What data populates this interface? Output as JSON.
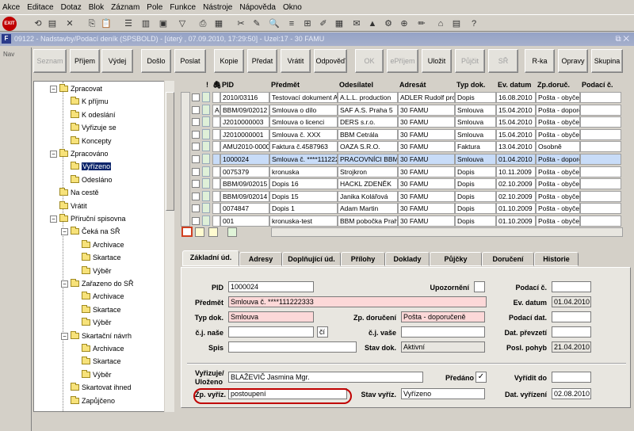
{
  "menu": [
    "Akce",
    "Editace",
    "Dotaz",
    "Blok",
    "Záznam",
    "Pole",
    "Funkce",
    "Nástroje",
    "Nápověda",
    "Okno"
  ],
  "toolbar": {
    "exit_label": "EXIT",
    "icons": [
      "save-icon",
      "print-icon",
      "cut-icon",
      "copy-icon",
      "paste-icon",
      "search-icon",
      "help-icon"
    ]
  },
  "window": {
    "title": "09122 - Nadstavby/Podací deník (SPSBOLD) - [úterý , 07.09.2010, 17:29:50] - Uzel:17 - 30 FAMU",
    "controls": "⧉ ✕"
  },
  "nav": {
    "label": "Nav"
  },
  "buttons": [
    {
      "label": "Seznam",
      "disabled": true
    },
    {
      "label": "Příjem",
      "disabled": false
    },
    {
      "label": "Výdej",
      "disabled": false
    },
    {
      "label": "Došlo",
      "disabled": false
    },
    {
      "label": "Poslat",
      "disabled": false
    },
    {
      "label": "Kopie",
      "disabled": false
    },
    {
      "label": "Předat",
      "disabled": false
    },
    {
      "label": "Vrátit",
      "disabled": false
    },
    {
      "label": "Odpověď",
      "disabled": false
    },
    {
      "label": "OK",
      "disabled": true
    },
    {
      "label": "ePříjem",
      "disabled": true
    },
    {
      "label": "Uložit",
      "disabled": false
    },
    {
      "label": "Půjčit",
      "disabled": true
    },
    {
      "label": "SŘ",
      "disabled": true
    },
    {
      "label": "R-ka",
      "disabled": false
    },
    {
      "label": "Opravy",
      "disabled": false
    },
    {
      "label": "Skupina",
      "disabled": false
    }
  ],
  "tree": [
    {
      "label": "Zpracovat"
    },
    {
      "label": "K příjmu"
    },
    {
      "label": "K odeslání"
    },
    {
      "label": "Vyřizuje se"
    },
    {
      "label": "Koncepty"
    },
    {
      "label": "Zpracováno"
    },
    {
      "label": "Vyřízeno"
    },
    {
      "label": "Odesláno"
    },
    {
      "label": "Na cestě"
    },
    {
      "label": "Vrátit"
    },
    {
      "label": "Příruční spisovna"
    },
    {
      "label": "Čeká na SŘ"
    },
    {
      "label": "Archivace"
    },
    {
      "label": "Skartace"
    },
    {
      "label": "Výběr"
    },
    {
      "label": "Zařazeno do SŘ"
    },
    {
      "label": "Archivace"
    },
    {
      "label": "Skartace"
    },
    {
      "label": "Výběr"
    },
    {
      "label": "Skartační návrh"
    },
    {
      "label": "Archivace"
    },
    {
      "label": "Skartace"
    },
    {
      "label": "Výběr"
    },
    {
      "label": "Skartovat ihned"
    },
    {
      "label": "Zapůjčeno"
    }
  ],
  "grid": {
    "headers": [
      "!",
      "PID",
      "Předmět",
      "Odesílatel",
      "Adresát",
      "Typ dok.",
      "Ev. datum",
      "Zp.doruč.",
      "Podací č."
    ],
    "rows": [
      {
        "flag": "",
        "pid": "2010/03116",
        "subject": "Testovací dokument A",
        "sender": "A.L.L. production",
        "recipient": "ADLER Rudolf prof",
        "type": "Dopis",
        "date": "16.08.2010",
        "delivery": "Pošta - obyče",
        "no": ""
      },
      {
        "flag": "A",
        "pid": "BBM/09/02012",
        "subject": "Smlouva o dílo",
        "sender": "SAF A.S. Praha 5",
        "recipient": "30 FAMU",
        "type": "Smlouva",
        "date": "15.04.2010",
        "delivery": "Pošta - dopore",
        "no": ""
      },
      {
        "flag": "",
        "pid": "J2010000003",
        "subject": "Smlouva o licenci",
        "sender": "DERS s.r.o.",
        "recipient": "30 FAMU",
        "type": "Smlouva",
        "date": "15.04.2010",
        "delivery": "Pošta - obyče",
        "no": ""
      },
      {
        "flag": "",
        "pid": "J2010000001",
        "subject": "Smlouva č. XXX",
        "sender": "BBM Cetrála",
        "recipient": "30 FAMU",
        "type": "Smlouva",
        "date": "15.04.2010",
        "delivery": "Pošta - obyče",
        "no": ""
      },
      {
        "flag": "",
        "pid": "AMU2010-0000",
        "subject": "Faktura č.4587963",
        "sender": "OAZA S.R.O.",
        "recipient": "30 FAMU",
        "type": "Faktura",
        "date": "13.04.2010",
        "delivery": "Osobně",
        "no": ""
      },
      {
        "flag": "",
        "pid": "1000024",
        "subject": "Smlouva č. ****111222",
        "sender": "PRACOVNÍCI BBM",
        "recipient": "30 FAMU",
        "type": "Smlouva",
        "date": "01.04.2010",
        "delivery": "Pošta - dopore",
        "no": ""
      },
      {
        "flag": "",
        "pid": "0075379",
        "subject": "kronuska",
        "sender": "Strojkron",
        "recipient": "30 FAMU",
        "type": "Dopis",
        "date": "10.11.2009",
        "delivery": "Pošta - obyče",
        "no": ""
      },
      {
        "flag": "",
        "pid": "BBM/09/02015",
        "subject": "Dopis 16",
        "sender": "HACKL ZDENĚK",
        "recipient": "30 FAMU",
        "type": "Dopis",
        "date": "02.10.2009",
        "delivery": "Pošta - obyče",
        "no": ""
      },
      {
        "flag": "",
        "pid": "BBM/09/02014",
        "subject": "Dopis 15",
        "sender": "Janika Kolářová",
        "recipient": "30 FAMU",
        "type": "Dopis",
        "date": "02.10.2009",
        "delivery": "Pošta - obyče",
        "no": ""
      },
      {
        "flag": "",
        "pid": "0074847",
        "subject": "Dopis 1",
        "sender": "Adam Martin",
        "recipient": "30 FAMU",
        "type": "Dopis",
        "date": "01.10.2009",
        "delivery": "Pošta - obyče",
        "no": ""
      },
      {
        "flag": "",
        "pid": "001",
        "subject": "kronuska-test",
        "sender": "BBM pobočka Prah",
        "recipient": "30 FAMU",
        "type": "Dopis",
        "date": "01.10.2009",
        "delivery": "Pošta - obyče",
        "no": ""
      }
    ],
    "selected_row": 5
  },
  "tabs": [
    "Základní úd.",
    "Adresy",
    "Doplňující úd.",
    "Přílohy",
    "Doklady",
    "Půjčky",
    "Doručení",
    "Historie"
  ],
  "form": {
    "pid_label": "PID",
    "pid": "1000024",
    "upozorneni_label": "Upozornění",
    "podaci_c_label": "Podací č.",
    "podaci_c": "",
    "predmet_label": "Předmět",
    "predmet": "Smlouva č. ****111222333",
    "ev_datum_label": "Ev. datum",
    "ev_datum": "01.04.2010",
    "typ_dok_label": "Typ dok.",
    "typ_dok": "Smlouva",
    "zp_doruceni_label": "Zp. doručení",
    "zp_doruceni": "Pošta - doporučeně",
    "podaci_dat_label": "Podací dat.",
    "podaci_dat": "",
    "cj_nase_label": "č.j. naše",
    "cj_nase": "",
    "ci_button": "čí",
    "cj_vase_label": "č.j. vaše",
    "cj_vase": "",
    "dat_prevzeti_label": "Dat. převzetí",
    "dat_prevzeti": "",
    "spis_label": "Spis",
    "spis": "",
    "stav_dok_label": "Stav dok.",
    "stav_dok": "Aktivní",
    "posl_pohyb_label": "Posl. pohyb",
    "posl_pohyb": "21.04.2010",
    "vyrizuje_label": "Vyřizuje/ Uloženo",
    "vyrizuje": "BLAŽEVIČ Jasmina Mgr.",
    "predano_label": "Předáno",
    "predano_check": "✓",
    "vyridit_do_label": "Vyřídit do",
    "vyridit_do": "",
    "zp_vyriz_label": "Zp. vyříz.",
    "zp_vyriz": "postoupení",
    "stav_vyriz_label": "Stav vyříz.",
    "stav_vyriz": "Vyřízeno",
    "dat_vyrizeni_label": "Dat. vyřízení",
    "dat_vyrizeni": "02.08.2010"
  }
}
